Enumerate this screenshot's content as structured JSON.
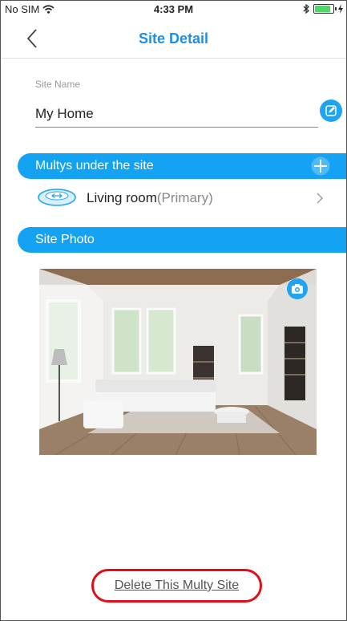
{
  "status_bar": {
    "carrier": "No SIM",
    "time": "4:33 PM",
    "battery_level": 0.85
  },
  "navbar": {
    "title": "Site Detail",
    "back_icon": "chevron-left-icon"
  },
  "site": {
    "name_label": "Site Name",
    "name_value": "My Home",
    "edit_icon": "edit-icon"
  },
  "multys_section": {
    "title": "Multys under the site",
    "add_icon": "plus-icon",
    "items": [
      {
        "name": "Living room",
        "role": "(Primary)",
        "icon": "router-icon"
      }
    ]
  },
  "photo_section": {
    "title": "Site Photo",
    "camera_icon": "camera-icon"
  },
  "actions": {
    "delete_label": "Delete This Multy Site"
  },
  "colors": {
    "accent": "#1e8ee8",
    "band": "#14a3f2",
    "highlight": "#e0101a"
  }
}
